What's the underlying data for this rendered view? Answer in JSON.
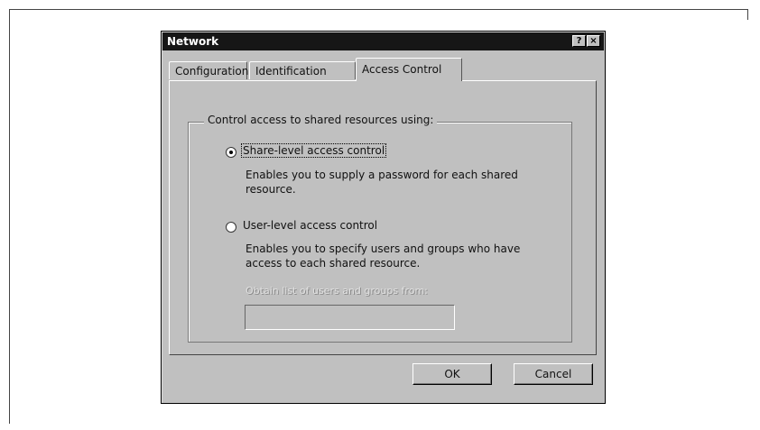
{
  "window": {
    "title": "Network",
    "help_button": "?",
    "close_button": "×"
  },
  "tabs": [
    {
      "label": "Configuration",
      "active": false
    },
    {
      "label": "Identification",
      "active": false
    },
    {
      "label": "Access Control",
      "active": true
    }
  ],
  "group": {
    "legend": "Control access to shared resources using:"
  },
  "options": [
    {
      "label": "Share-level access control",
      "description": "Enables you to supply a password for each shared resource.",
      "selected": true
    },
    {
      "label": "User-level access control",
      "description": "Enables you to specify users and groups who have access to each shared resource.",
      "selected": false
    }
  ],
  "obtain_list": {
    "label": "Obtain list of users and groups from:",
    "value": ""
  },
  "buttons": {
    "ok": "OK",
    "cancel": "Cancel"
  }
}
